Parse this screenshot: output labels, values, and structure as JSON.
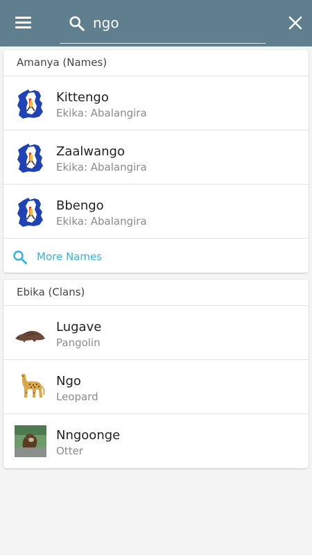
{
  "app": {
    "menu_icon": "menu-icon",
    "search_icon": "search-icon",
    "close_icon": "close-icon",
    "search_value": "ngo",
    "accent_color": "#5f7e8e",
    "link_color": "#29b6e8"
  },
  "names": {
    "header": "Amanya (Names)",
    "items": [
      {
        "title": "Kittengo",
        "subtitle": "Ekika: Abalangira",
        "icon": "uganda-flag-map-icon"
      },
      {
        "title": "Zaalwango",
        "subtitle": "Ekika: Abalangira",
        "icon": "uganda-flag-map-icon"
      },
      {
        "title": "Bbengo",
        "subtitle": "Ekika: Abalangira",
        "icon": "uganda-flag-map-icon"
      }
    ],
    "more_label": "More Names"
  },
  "clans": {
    "header": "Ebika (Clans)",
    "items": [
      {
        "title": "Lugave",
        "subtitle": "Pangolin",
        "icon": "pangolin-image"
      },
      {
        "title": "Ngo",
        "subtitle": "Leopard",
        "icon": "leopard-image"
      },
      {
        "title": "Nngoonge",
        "subtitle": "Otter",
        "icon": "otter-image"
      }
    ]
  }
}
